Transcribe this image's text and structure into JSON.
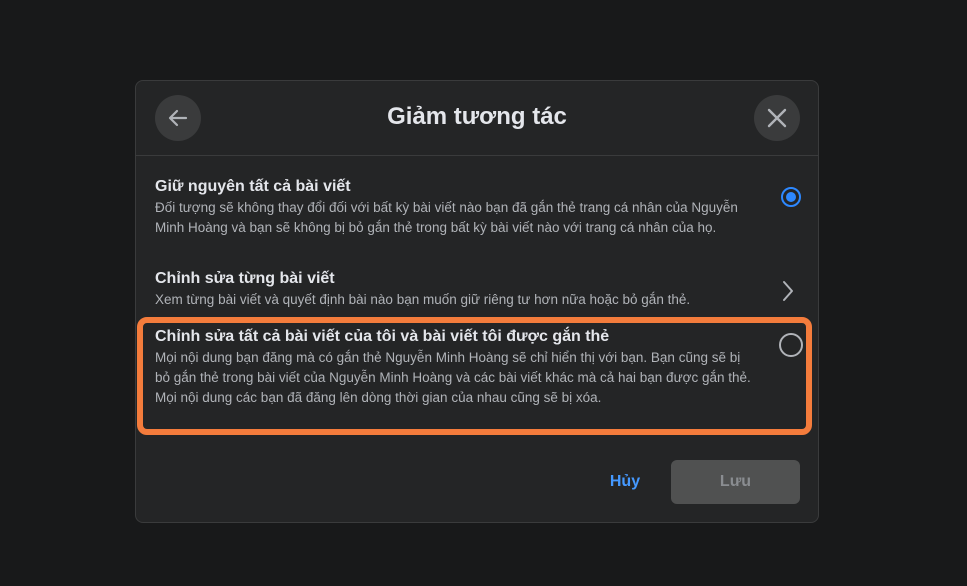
{
  "dialog": {
    "title": "Giảm tương tác",
    "back_icon": "arrow-left-icon",
    "close_icon": "close-icon"
  },
  "options": [
    {
      "title": "Giữ nguyên tất cả bài viết",
      "description": "Đối tượng sẽ không thay đổi đối với bất kỳ bài viết nào bạn đã gắn thẻ trang cá nhân của Nguyễn Minh Hoàng và bạn sẽ không bị bỏ gắn thẻ trong bất kỳ bài viết nào với trang cá nhân của họ.",
      "control": "radio",
      "selected": true
    },
    {
      "title": "Chỉnh sửa từng bài viết",
      "description": "Xem từng bài viết và quyết định bài nào bạn muốn giữ riêng tư hơn nữa hoặc bỏ gắn thẻ.",
      "control": "chevron-right-icon"
    },
    {
      "title": "Chỉnh sửa tất cả bài viết của tôi và bài viết tôi được gắn thẻ",
      "description": "Mọi nội dung bạn đăng mà có gắn thẻ Nguyễn Minh Hoàng sẽ chỉ hiển thị với bạn. Bạn cũng sẽ bị bỏ gắn thẻ trong bài viết của Nguyễn Minh Hoàng và các bài viết khác mà cả hai bạn được gắn thẻ. Mọi nội dung các bạn đã đăng lên dòng thời gian của nhau cũng sẽ bị xóa.",
      "control": "radio",
      "selected": false,
      "highlighted": true
    }
  ],
  "footer": {
    "cancel_label": "Hủy",
    "save_label": "Lưu"
  },
  "colors": {
    "accent": "#2d88ff",
    "highlight": "#f47c3c",
    "link": "#4599ff"
  }
}
